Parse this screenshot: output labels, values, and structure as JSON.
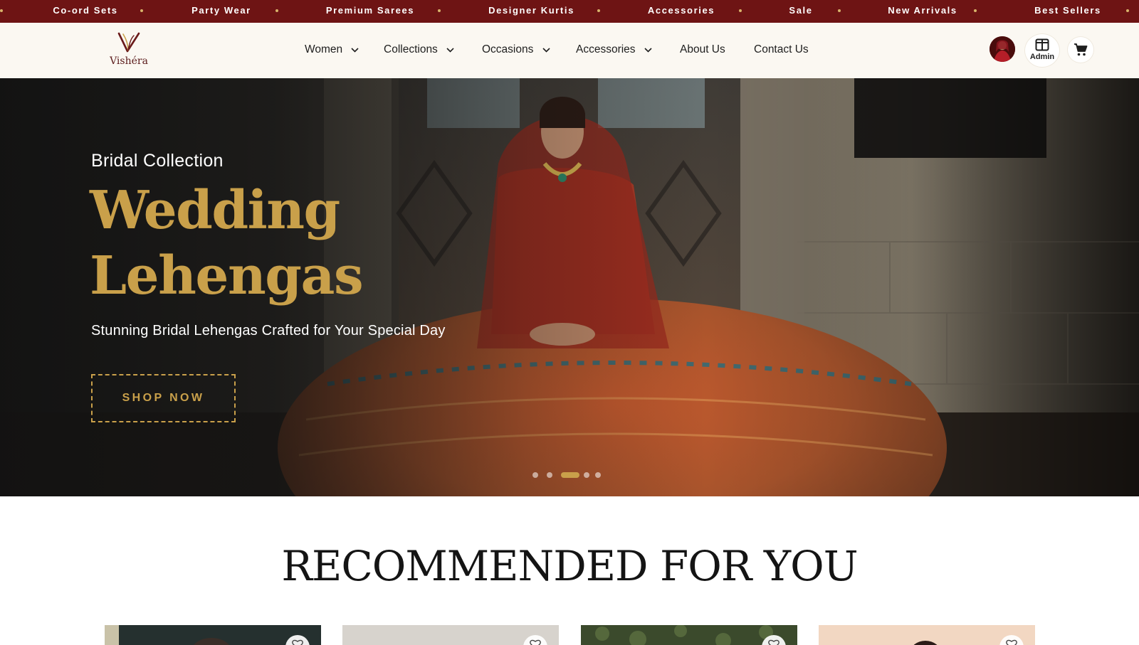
{
  "ticker": {
    "items": [
      "Co-ord Sets",
      "Party Wear",
      "Premium Sarees",
      "Designer Kurtis",
      "Accessories",
      "Sale",
      "New Arrivals",
      "Best Sellers"
    ]
  },
  "brand": {
    "name": "Vishéra",
    "primary_color": "#6e1414",
    "accent_gold": "#c9a04a"
  },
  "nav": {
    "links": [
      {
        "label": "Women",
        "icon": "chevron-down-icon"
      },
      {
        "label": "Collections",
        "icon": "chevron-down-icon"
      },
      {
        "label": "Occasions",
        "icon": "chevron-down-icon"
      },
      {
        "label": "Accessories",
        "icon": "chevron-down-icon"
      },
      {
        "label": "About Us"
      },
      {
        "label": "Contact Us"
      }
    ],
    "admin_label": "Admin",
    "icons": [
      "avatar",
      "admin-panel-icon",
      "cart-icon"
    ]
  },
  "hero": {
    "eyebrow": "Bridal Collection",
    "title_line1": "Wedding",
    "title_line2": "Lehengas",
    "subtitle": "Stunning Bridal Lehengas Crafted for Your Special Day",
    "cta": "SHOP NOW",
    "slide_count": 5,
    "active_slide": 2
  },
  "recommended": {
    "title": "RECOMMENDED FOR YOU",
    "cards": [
      {
        "icon": "heart-icon"
      },
      {
        "icon": "heart-icon"
      },
      {
        "icon": "heart-icon"
      },
      {
        "icon": "heart-icon"
      }
    ]
  }
}
